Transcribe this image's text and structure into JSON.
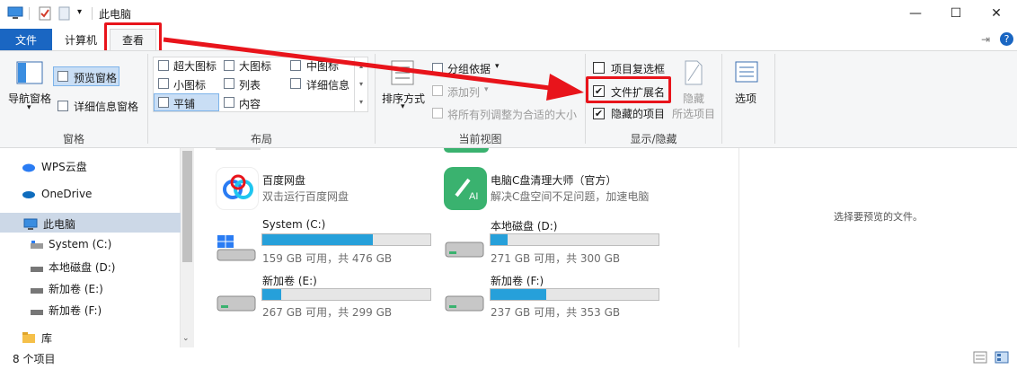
{
  "window": {
    "title": "此电脑",
    "minimize_glyph": "—",
    "maximize_glyph": "☐",
    "close_glyph": "✕"
  },
  "tabs": {
    "file": "文件",
    "computer": "计算机",
    "view": "查看"
  },
  "ribbon": {
    "panes": {
      "nav_pane": "导航窗格",
      "preview_pane": "预览窗格",
      "details_pane": "详细信息窗格",
      "group": "窗格"
    },
    "layout": {
      "items": [
        "超大图标",
        "大图标",
        "中图标",
        "小图标",
        "列表",
        "详细信息",
        "平铺",
        "内容"
      ],
      "group": "布局"
    },
    "current_view": {
      "sort": "排序方式",
      "group_by": "分组依据",
      "add_columns": "添加列",
      "fit_columns": "将所有列调整为合适的大小",
      "group": "当前视图"
    },
    "show_hide": {
      "item_checkboxes": "项目复选框",
      "file_extensions": "文件扩展名",
      "hidden_items": "隐藏的项目",
      "hide_selected": "隐藏",
      "hide_selected_sub": "所选项目",
      "group": "显示/隐藏",
      "item_checkboxes_checked": false,
      "file_extensions_checked": true,
      "hidden_items_checked": true
    },
    "options": "选项"
  },
  "nav": {
    "items": [
      {
        "label": "WPS云盘",
        "icon": "cloud-icon"
      },
      {
        "label": "OneDrive",
        "icon": "onedrive-icon"
      },
      {
        "label": "此电脑",
        "icon": "pc-icon"
      },
      {
        "label": "System (C:)",
        "icon": "drive-icon"
      },
      {
        "label": "本地磁盘 (D:)",
        "icon": "drive-icon"
      },
      {
        "label": "新加卷 (E:)",
        "icon": "drive-icon"
      },
      {
        "label": "新加卷 (F:)",
        "icon": "drive-icon"
      },
      {
        "label": "库",
        "icon": "library-icon"
      }
    ]
  },
  "content": {
    "apps": [
      {
        "name": "百度网盘",
        "desc": "双击运行百度网盘"
      },
      {
        "name": "电脑C盘清理大师（官方）",
        "desc": "解决C盘空间不足问题，加速电脑"
      }
    ],
    "drives": [
      {
        "name": "System (C:)",
        "free": "159 GB 可用，共 476 GB",
        "used_fraction": 0.66
      },
      {
        "name": "本地磁盘 (D:)",
        "free": "271 GB 可用，共 300 GB",
        "used_fraction": 0.1
      },
      {
        "name": "新加卷 (E:)",
        "free": "267 GB 可用，共 299 GB",
        "used_fraction": 0.11
      },
      {
        "name": "新加卷 (F:)",
        "free": "237 GB 可用，共 353 GB",
        "used_fraction": 0.33
      }
    ],
    "preview_empty": "选择要预览的文件。"
  },
  "status": {
    "count": "8 个项目"
  },
  "colors": {
    "accent": "#1a66c2",
    "highlight": "#e8141b",
    "bar_fill": "#26a0da"
  }
}
